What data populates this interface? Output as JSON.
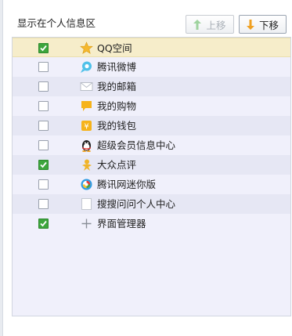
{
  "panel": {
    "title": "显示在个人信息区",
    "up_label": "上移",
    "down_label": "下移"
  },
  "items": [
    {
      "label": "QQ空间",
      "checked": true,
      "icon": "star-icon"
    },
    {
      "label": "腾讯微博",
      "checked": false,
      "icon": "weibo-icon"
    },
    {
      "label": "我的邮箱",
      "checked": false,
      "icon": "mail-icon"
    },
    {
      "label": "我的购物",
      "checked": false,
      "icon": "shopping-flag-icon"
    },
    {
      "label": "我的钱包",
      "checked": false,
      "icon": "wallet-icon"
    },
    {
      "label": "超级会员信息中心",
      "checked": false,
      "icon": "qq-penguin-icon"
    },
    {
      "label": "大众点评",
      "checked": true,
      "icon": "dianping-icon"
    },
    {
      "label": "腾讯网迷你版",
      "checked": false,
      "icon": "tencent-mini-icon"
    },
    {
      "label": "搜搜问问个人中心",
      "checked": false,
      "icon": "soso-wenwen-icon"
    },
    {
      "label": "界面管理器",
      "checked": true,
      "icon": "plus-icon"
    }
  ],
  "colors": {
    "selected_row": "#f6edca",
    "alt_row": "#e6e7f4",
    "checkbox_checked": "#3da53d",
    "up_arrow": "#9fd39f",
    "down_arrow": "#f0a020"
  }
}
